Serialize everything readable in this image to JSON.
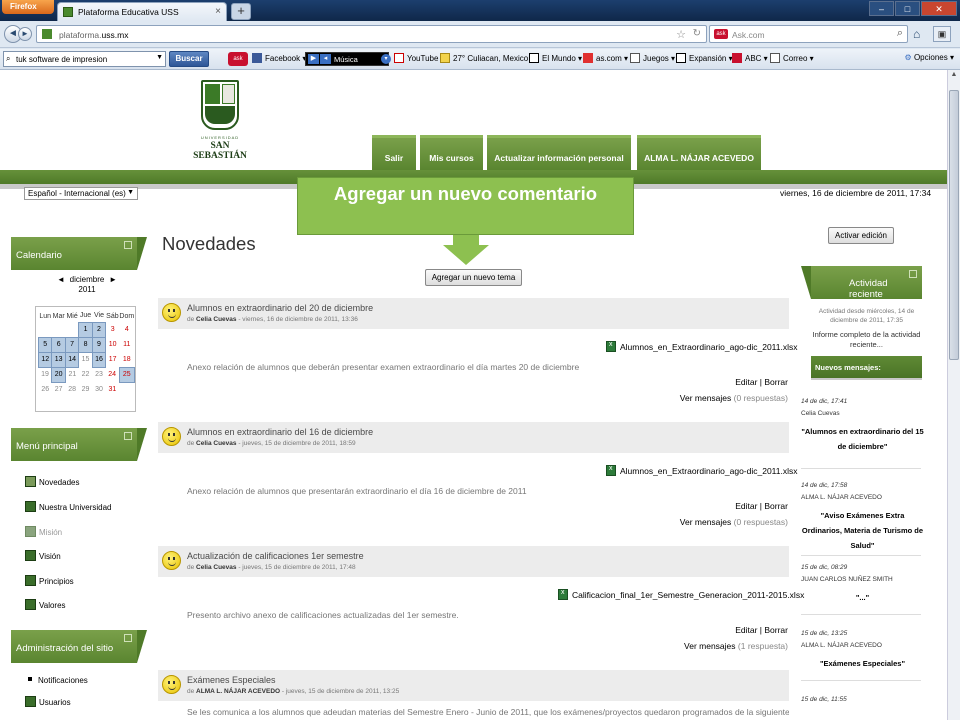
{
  "browser": {
    "app_button": "Firefox",
    "tab_title": "Plataforma Educativa USS",
    "new_tab": "+",
    "url_prefix": "plataforma.",
    "url_host": "uss.mx",
    "search_engine_placeholder": "Ask.com",
    "toolbar_search_value": "tuk software de impresion",
    "toolbar_search_button": "Buscar",
    "bookmarks": [
      {
        "label": "Facebook ▾",
        "icon": "facebook-icon"
      },
      {
        "label": "YouTube",
        "icon": "youtube-icon"
      },
      {
        "label": "27° Culiacan, Mexico ▾",
        "icon": "weather-icon"
      },
      {
        "label": "El Mundo ▾",
        "icon": "newspaper-icon"
      },
      {
        "label": "as.com ▾",
        "icon": "as-icon"
      },
      {
        "label": "Juegos ▾",
        "icon": "games-icon"
      },
      {
        "label": "Expansión ▾",
        "icon": "expansion-icon"
      },
      {
        "label": "ABC ▾",
        "icon": "abc-icon"
      },
      {
        "label": "Correo ▾",
        "icon": "mail-icon"
      }
    ],
    "music_label": "Música",
    "options_label": "Opciones ▾"
  },
  "site": {
    "logo_university": "UNIVERSIDAD",
    "logo_name": "SAN SEBASTIÁN",
    "top_menu": [
      "Salir",
      "Mis cursos",
      "Actualizar información personal",
      "ALMA L. NÁJAR ACEVEDO"
    ],
    "language": "Español - Internacional (es)",
    "datetime": "viernes, 16 de diciembre de 2011, 17:34",
    "brand_green": "#5a8530"
  },
  "callout": {
    "text": "Agregar un nuevo comentario",
    "color": "#8dc050"
  },
  "calendar": {
    "block_title": "Calendario",
    "prev": "◄",
    "next": "►",
    "month": "diciembre",
    "year": "2011",
    "weekdays": [
      "Lun",
      "Mar",
      "Mié",
      "Jue",
      "Vie",
      "Sáb",
      "Dom"
    ],
    "weeks": [
      [
        "",
        "",
        "",
        "1",
        "2",
        "3",
        "4"
      ],
      [
        "5",
        "6",
        "7",
        "8",
        "9",
        "10",
        "11"
      ],
      [
        "12",
        "13",
        "14",
        "15",
        "16",
        "17",
        "18"
      ],
      [
        "19",
        "20",
        "21",
        "22",
        "23",
        "24",
        "25"
      ],
      [
        "26",
        "27",
        "28",
        "29",
        "30",
        "31",
        ""
      ]
    ]
  },
  "main_menu": {
    "block_title": "Menú principal",
    "items": [
      {
        "label": "Novedades",
        "icon": "forum-icon",
        "dim": false
      },
      {
        "label": "Nuestra Universidad",
        "icon": "forum-icon",
        "dim": false
      },
      {
        "label": "Misión",
        "icon": "forum-icon",
        "dim": true
      },
      {
        "label": "Visión",
        "icon": "forum-icon",
        "dim": false
      },
      {
        "label": "Principios",
        "icon": "forum-icon",
        "dim": false
      },
      {
        "label": "Valores",
        "icon": "forum-icon",
        "dim": false
      }
    ]
  },
  "admin": {
    "block_title": "Administración del sitio",
    "items": [
      {
        "label": "Notificaciones",
        "icon": "bullet-icon"
      },
      {
        "label": "Usuarios",
        "icon": "users-icon"
      }
    ]
  },
  "main": {
    "heading": "Novedades",
    "edit_mode_button": "Activar edición",
    "add_topic_button": "Agregar un nuevo tema",
    "posts": [
      {
        "title": "Alumnos en extraordinario del 20 de diciembre",
        "by_prefix": "de ",
        "author": "Celia Cuevas",
        "date": " - viernes, 16 de diciembre de 2011, 13:36",
        "attachment": "Alumnos_en_Extraordinario_ago-dic_2011.xlsx",
        "message": "Anexo relación de alumnos que deberán presentar examen extraordinario el día martes 20 de diciembre",
        "edit": "Editar",
        "delete": "Borrar",
        "view": "Ver mensajes",
        "replies": "(0 respuestas)"
      },
      {
        "title": "Alumnos en extraordinario del 16 de diciembre",
        "by_prefix": "de ",
        "author": "Celia Cuevas",
        "date": " - jueves, 15 de diciembre de 2011, 18:59",
        "attachment": "Alumnos_en_Extraordinario_ago-dic_2011.xlsx",
        "message": "Anexo relación de alumnos que presentarán extraordinario el día 16 de diciembre de 2011",
        "edit": "Editar",
        "delete": "Borrar",
        "view": "Ver mensajes",
        "replies": "(0 respuestas)"
      },
      {
        "title": "Actualización de calificaciones 1er semestre",
        "by_prefix": "de ",
        "author": "Celia Cuevas",
        "date": " - jueves, 15 de diciembre de 2011, 17:48",
        "attachment": "Calificacion_final_1er_Semestre_Generacion_2011-2015.xlsx",
        "message": "Presento archivo anexo de calificaciones actualizadas del 1er semestre.",
        "edit": "Editar",
        "delete": "Borrar",
        "view": "Ver mensajes",
        "replies": "(1 respuesta)"
      },
      {
        "title": "Exámenes Especiales",
        "by_prefix": "de ",
        "author": "ALMA L. NÁJAR ACEVEDO",
        "date": " - jueves, 15 de diciembre de 2011, 13:25",
        "message": "Se les comunica a los alumnos que adeudan materias del Semestre Enero - Junio de 2011, que los exámenes/proyectos quedaron programados de la siguiente manera:"
      }
    ]
  },
  "recent": {
    "block_title": "Actividad reciente",
    "since": "Actividad desde miércoles, 14 de diciembre de 2011, 17:35",
    "report": "Informe completo de la actividad reciente...",
    "new_messages_title": "Nuevos mensajes:",
    "items": [
      {
        "date": "14 de dic, 17:41",
        "author": "Celia Cuevas",
        "title": "\"Alumnos en extraordinario del 15 de diciembre\""
      },
      {
        "date": "14 de dic, 17:58",
        "author": "ALMA L. NÁJAR ACEVEDO",
        "title": "\"Aviso Exámenes Extra Ordinarios, Materia de Turismo de Salud\""
      },
      {
        "date": "15 de dic, 08:29",
        "author": "JUAN CARLOS NUÑEZ SMITH",
        "title": "\"...\""
      },
      {
        "date": "15 de dic, 13:25",
        "author": "ALMA L. NÁJAR ACEVEDO",
        "title": "\"Exámenes Especiales\""
      },
      {
        "date": "15 de dic, 11:55"
      }
    ]
  }
}
